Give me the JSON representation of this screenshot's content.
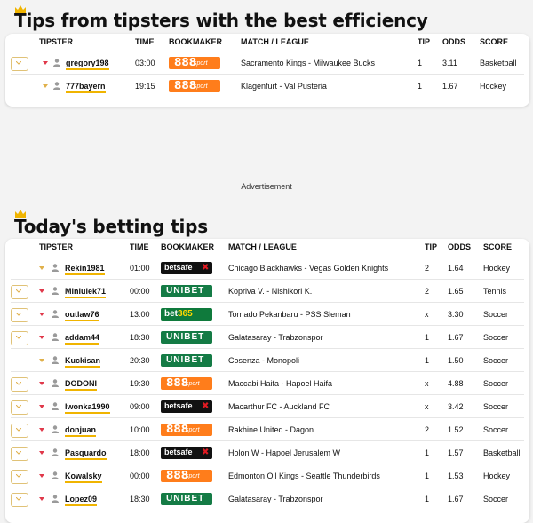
{
  "section1": {
    "title": "Tips from tipsters with the best efficiency",
    "headers": {
      "tipster": "TIPSTER",
      "time": "TIME",
      "bookmaker": "BOOKMAKER",
      "match": "MATCH / LEAGUE",
      "tip": "TIP",
      "odds": "ODDS",
      "score": "SCORE"
    },
    "rows": [
      {
        "tipster": "gregory198",
        "time": "03:00",
        "bookmaker": "888",
        "bookmaker_sub": "sport",
        "match": "Sacramento Kings - Milwaukee Bucks",
        "tip": "1",
        "odds": "3.11",
        "score": "Basketball",
        "add_button": true
      },
      {
        "tipster": "777bayern",
        "time": "19:15",
        "bookmaker": "888",
        "bookmaker_sub": "sport",
        "match": "Klagenfurt - Val Pusteria",
        "tip": "1",
        "odds": "1.67",
        "score": "Hockey",
        "add_button": false
      }
    ]
  },
  "advertisement": "Advertisement",
  "section2": {
    "title": "Today's betting tips",
    "headers": {
      "tipster": "TIPSTER",
      "time": "TIME",
      "bookmaker": "BOOKMAKER",
      "match": "MATCH / LEAGUE",
      "tip": "TIP",
      "odds": "ODDS",
      "score": "SCORE"
    },
    "rows": [
      {
        "tipster": "Rekin1981",
        "time": "01:00",
        "bookmaker": "betsafe",
        "match": "Chicago Blackhawks - Vegas Golden Knights",
        "tip": "2",
        "odds": "1.64",
        "score": "Hockey",
        "add_button": false
      },
      {
        "tipster": "Miniulek71",
        "time": "00:00",
        "bookmaker": "UNIBET",
        "match": "Kopriva V. - Nishikori K.",
        "tip": "2",
        "odds": "1.65",
        "score": "Tennis",
        "add_button": true
      },
      {
        "tipster": "outlaw76",
        "time": "13:00",
        "bookmaker": "bet365",
        "match": "Tornado Pekanbaru - PSS Sleman",
        "tip": "x",
        "odds": "3.30",
        "score": "Soccer",
        "add_button": true
      },
      {
        "tipster": "addam44",
        "time": "18:30",
        "bookmaker": "UNIBET",
        "match": "Galatasaray - Trabzonspor",
        "tip": "1",
        "odds": "1.67",
        "score": "Soccer",
        "add_button": true
      },
      {
        "tipster": "Kuckisan",
        "time": "20:30",
        "bookmaker": "UNIBET",
        "match": "Cosenza - Monopoli",
        "tip": "1",
        "odds": "1.50",
        "score": "Soccer",
        "add_button": false
      },
      {
        "tipster": "DODONI",
        "time": "19:30",
        "bookmaker": "888",
        "bookmaker_sub": "sport",
        "match": "Maccabi Haifa - Hapoel Haifa",
        "tip": "x",
        "odds": "4.88",
        "score": "Soccer",
        "add_button": true
      },
      {
        "tipster": "Iwonka1990",
        "time": "09:00",
        "bookmaker": "betsafe",
        "match": "Macarthur FC - Auckland FC",
        "tip": "x",
        "odds": "3.42",
        "score": "Soccer",
        "add_button": true
      },
      {
        "tipster": "donjuan",
        "time": "10:00",
        "bookmaker": "888",
        "bookmaker_sub": "sport",
        "match": "Rakhine United - Dagon",
        "tip": "2",
        "odds": "1.52",
        "score": "Soccer",
        "add_button": true
      },
      {
        "tipster": "Pasquardo",
        "time": "18:00",
        "bookmaker": "betsafe",
        "match": "Holon W - Hapoel Jerusalem W",
        "tip": "1",
        "odds": "1.57",
        "score": "Basketball",
        "add_button": true
      },
      {
        "tipster": "Kowalsky",
        "time": "00:00",
        "bookmaker": "888",
        "bookmaker_sub": "sport",
        "match": "Edmonton Oil Kings - Seattle Thunderbirds",
        "tip": "1",
        "odds": "1.53",
        "score": "Hockey",
        "add_button": true
      },
      {
        "tipster": "Lopez09",
        "time": "18:30",
        "bookmaker": "UNIBET",
        "match": "Galatasaray - Trabzonspor",
        "tip": "1",
        "odds": "1.67",
        "score": "Soccer",
        "add_button": true
      }
    ]
  },
  "colors": {
    "accent": "#f0b400",
    "caret": "#e0384a",
    "888": "#ff7d1b",
    "unibet": "#147b45",
    "bet365": "#0f7a3c",
    "betsafe": "#111111"
  }
}
